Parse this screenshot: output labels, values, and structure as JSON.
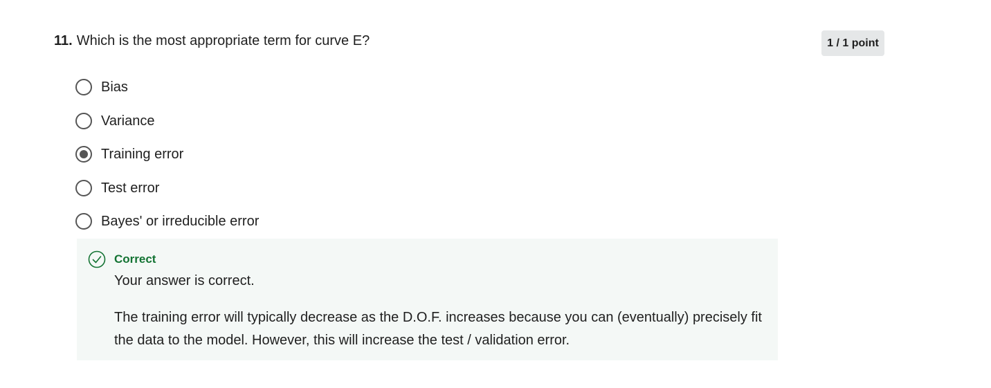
{
  "question": {
    "number": "11.",
    "text": "Which is the most appropriate term for curve E?",
    "points": "1 / 1 point"
  },
  "options": [
    {
      "label": "Bias",
      "selected": false
    },
    {
      "label": "Variance",
      "selected": false
    },
    {
      "label": "Training error",
      "selected": true
    },
    {
      "label": "Test error",
      "selected": false
    },
    {
      "label": "Bayes' or irreducible error",
      "selected": false
    }
  ],
  "feedback": {
    "status": "Correct",
    "icon": "check-circle-icon",
    "message": "Your answer is correct.",
    "explanation": "The training error will typically decrease as the D.O.F. increases because you can (eventually) precisely fit the data to the model. However, this will increase the test / validation error."
  },
  "colors": {
    "correct": "#137333",
    "radio": "#555555",
    "feedback_bg": "#f4f8f6",
    "badge_bg": "#e5e7e8"
  }
}
